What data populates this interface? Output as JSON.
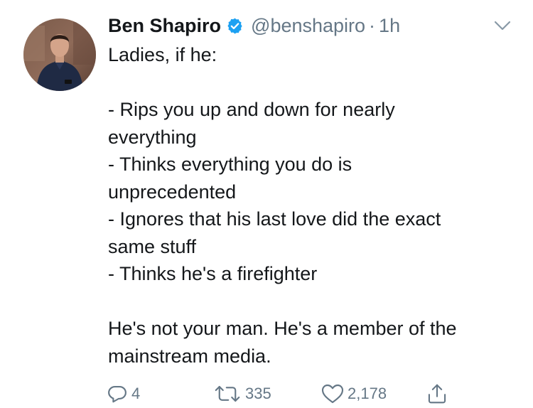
{
  "tweet": {
    "display_name": "Ben Shapiro",
    "handle": "@benshapiro",
    "separator": "·",
    "time": "1h",
    "body_lines": [
      "Ladies, if he:",
      "",
      "- Rips you up and down for nearly",
      "everything",
      "- Thinks everything you do is",
      "unprecedented",
      "- Ignores that his last love did the exact",
      "same stuff",
      "- Thinks he's a firefighter",
      "",
      "He's not your man. He's a member of the",
      "mainstream media."
    ],
    "actions": {
      "replies": "4",
      "retweets": "335",
      "likes": "2,178"
    }
  },
  "icons": {
    "verified": "verified-badge-icon",
    "caret": "chevron-down-icon",
    "reply": "reply-icon",
    "retweet": "retweet-icon",
    "like": "heart-icon",
    "share": "share-icon"
  },
  "colors": {
    "verified_blue": "#1da1f2",
    "text": "#14171a",
    "muted": "#657786"
  }
}
